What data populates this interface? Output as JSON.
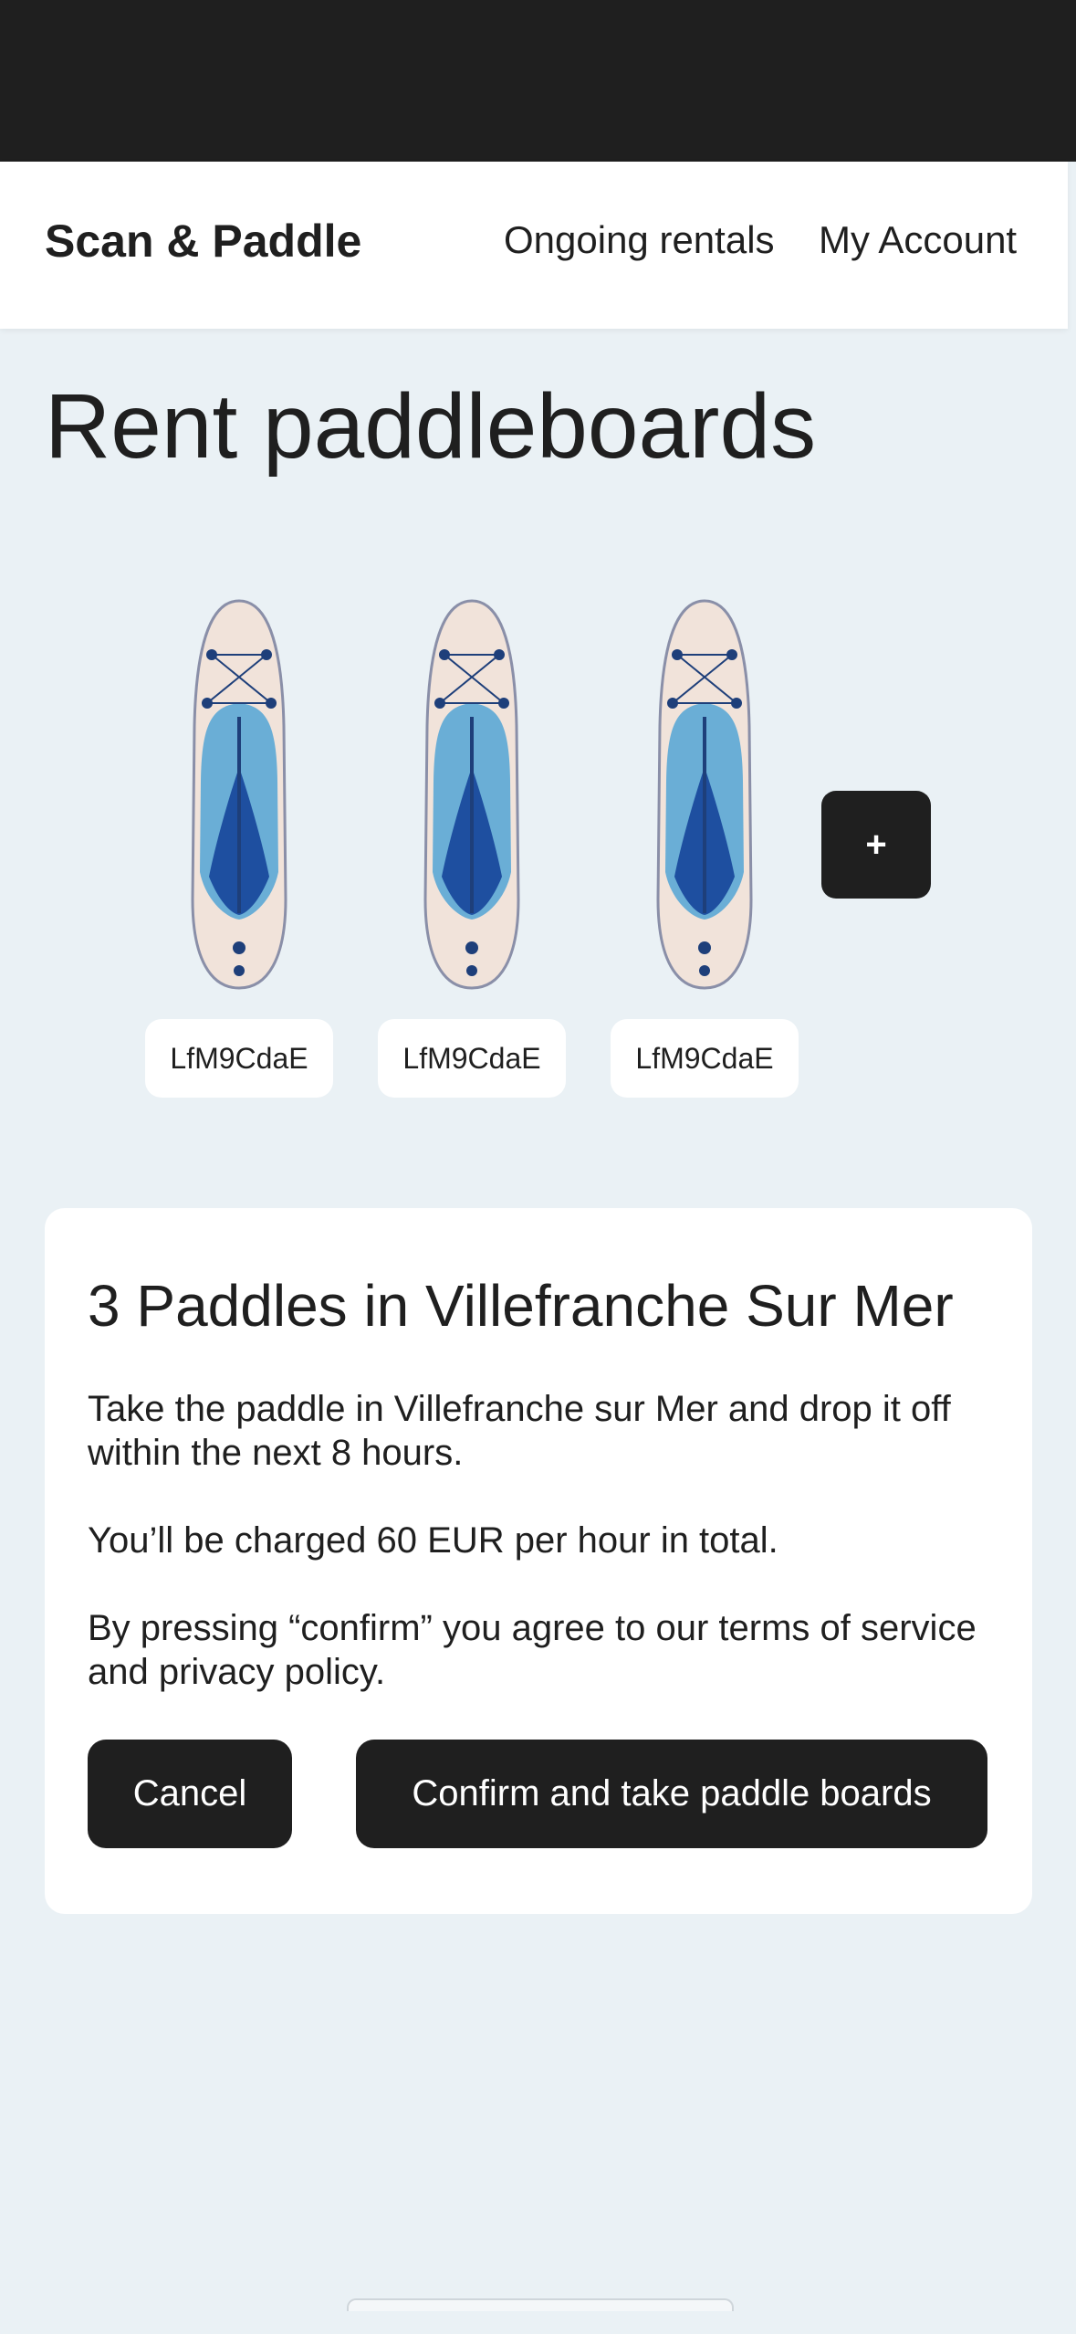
{
  "header": {
    "brand": "Scan & Paddle",
    "nav": {
      "ongoing_rentals": "Ongoing rentals",
      "my_account": "My Account"
    }
  },
  "page": {
    "title": "Rent paddleboards"
  },
  "boards": [
    {
      "code": "LfM9CdaE"
    },
    {
      "code": "LfM9CdaE"
    },
    {
      "code": "LfM9CdaE"
    }
  ],
  "add_button": {
    "label": "+"
  },
  "summary": {
    "title": "3 Paddles in Villefranche Sur Mer",
    "description": "Take the paddle in Villefranche sur Mer and drop it off within the next 8 hours.",
    "charge_text": "You’ll be charged 60 EUR per hour in total.",
    "terms_text": "By pressing “confirm” you agree to our terms of service and privacy policy.",
    "cancel_label": "Cancel",
    "confirm_label": "Confirm and take paddle boards"
  },
  "colors": {
    "page_background": "#eaf1f5",
    "dark": "#1f1f1f",
    "board_light_blue": "#6aaed6",
    "board_dark_blue": "#1e4fa0",
    "board_cream": "#f1e3da"
  }
}
